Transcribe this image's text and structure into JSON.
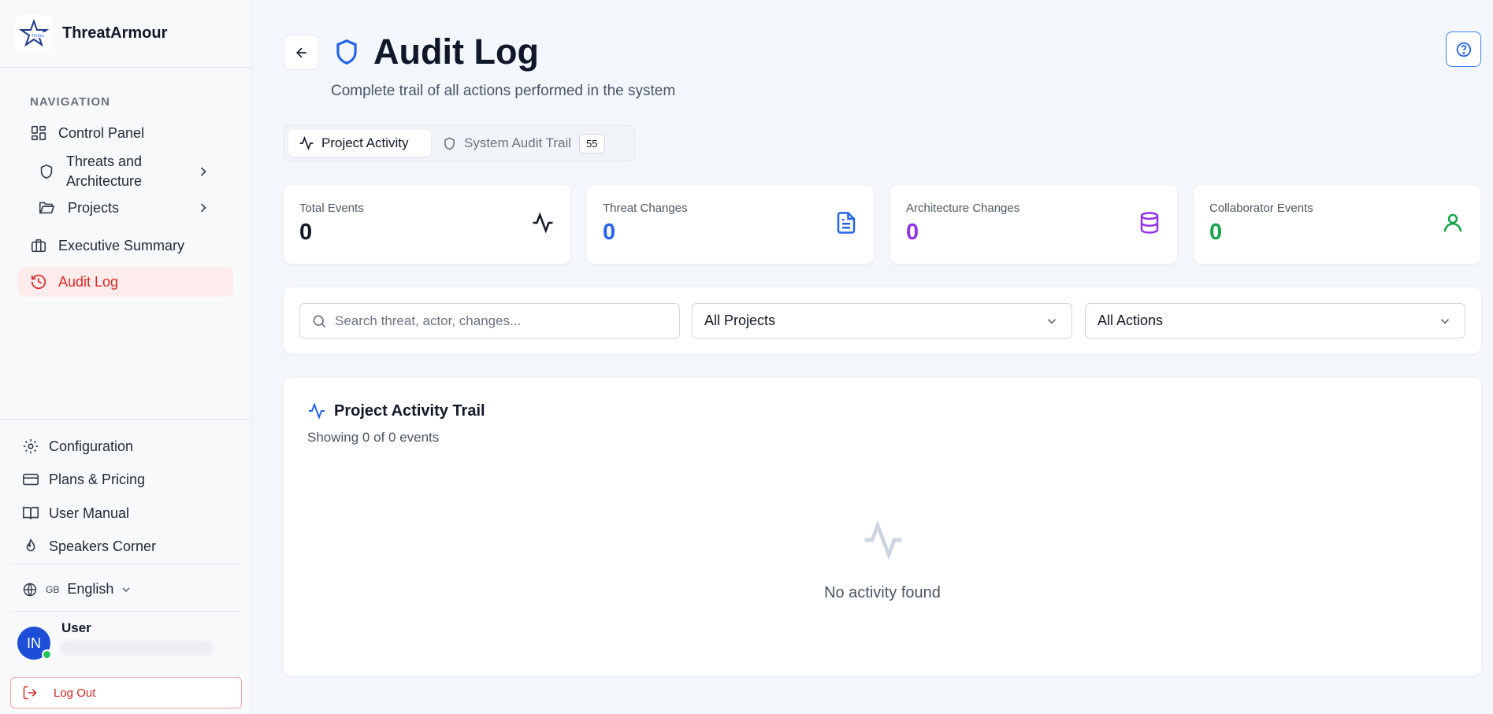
{
  "brand": {
    "name": "ThreatArmour"
  },
  "nav": {
    "heading": "NAVIGATION",
    "items": [
      {
        "label": "Control Panel",
        "icon": "dashboard-icon"
      },
      {
        "label": "Threats and Architecture",
        "icon": "shield-icon"
      },
      {
        "label": "Projects",
        "icon": "folder-icon"
      },
      {
        "label": "Executive Summary",
        "icon": "briefcase-icon"
      },
      {
        "label": "Audit Log",
        "icon": "history-icon",
        "active": true
      }
    ]
  },
  "bottom_nav": [
    {
      "label": "Configuration",
      "icon": "gear-icon"
    },
    {
      "label": "Plans & Pricing",
      "icon": "credit-card-icon"
    },
    {
      "label": "User Manual",
      "icon": "book-icon"
    },
    {
      "label": "Speakers Corner",
      "icon": "flame-icon"
    }
  ],
  "language": {
    "flag": "GB",
    "label": "English"
  },
  "user": {
    "initials": "IN",
    "name": "User",
    "status_color": "#22c55e"
  },
  "logout": {
    "label": "Log Out"
  },
  "page": {
    "title": "Audit Log",
    "subtitle": "Complete trail of all actions performed in the system"
  },
  "tabs": [
    {
      "label": "Project Activity",
      "active": true,
      "icon": "activity-icon"
    },
    {
      "label": "System Audit Trail",
      "badge": "55",
      "icon": "shield-icon"
    }
  ],
  "stats": [
    {
      "label": "Total Events",
      "value": "0",
      "color": "#111827",
      "icon": "activity-icon"
    },
    {
      "label": "Threat Changes",
      "value": "0",
      "color": "#2563eb",
      "icon": "file-text-icon"
    },
    {
      "label": "Architecture Changes",
      "value": "0",
      "color": "#9333ea",
      "icon": "database-icon"
    },
    {
      "label": "Collaborator Events",
      "value": "0",
      "color": "#16a34a",
      "icon": "user-icon"
    }
  ],
  "filters": {
    "search_placeholder": "Search threat, actor, changes...",
    "project_select": "All Projects",
    "action_select": "All Actions"
  },
  "trail": {
    "title": "Project Activity Trail",
    "count_text": "Showing 0 of 0 events",
    "empty_text": "No activity found"
  },
  "colors": {
    "accent": "#2563eb",
    "danger": "#dc2626"
  }
}
